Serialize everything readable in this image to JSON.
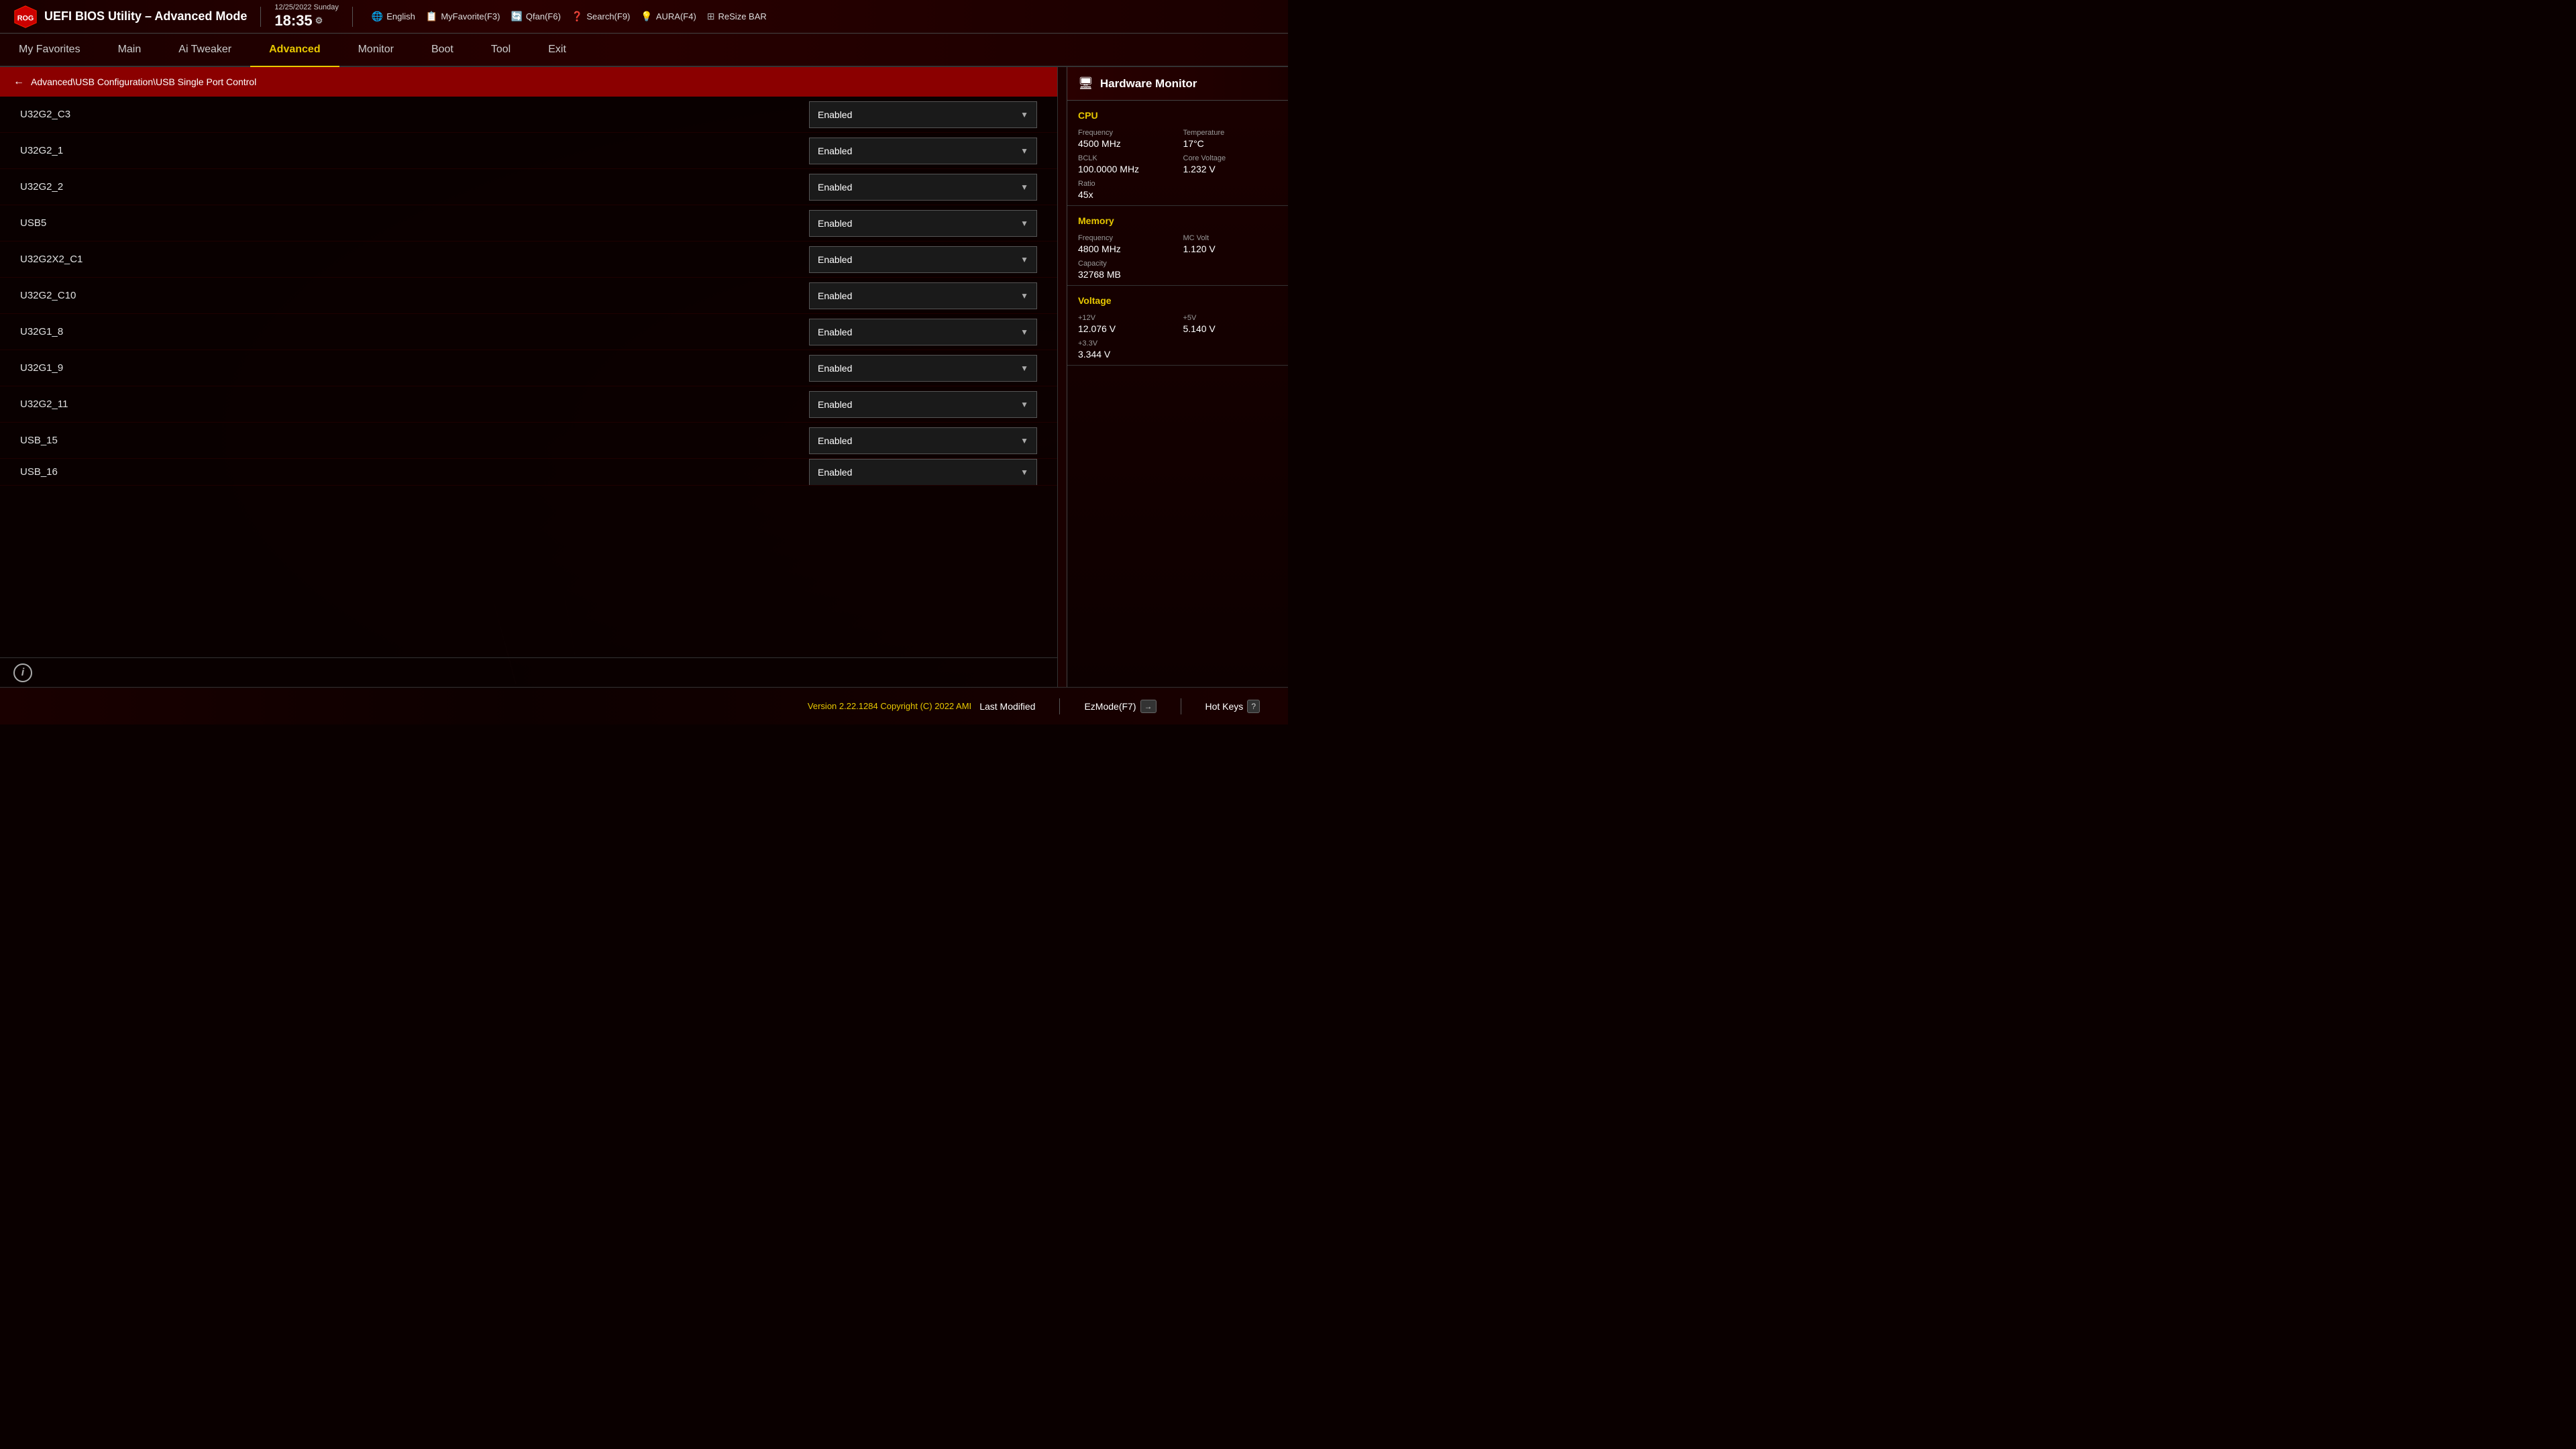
{
  "header": {
    "title": "UEFI BIOS Utility – Advanced Mode",
    "date": "12/25/2022",
    "day": "Sunday",
    "time": "18:35",
    "tools": [
      {
        "id": "english",
        "icon": "🌐",
        "label": "English"
      },
      {
        "id": "myfavorite",
        "icon": "📋",
        "label": "MyFavorite(F3)"
      },
      {
        "id": "qfan",
        "icon": "🔄",
        "label": "Qfan(F6)"
      },
      {
        "id": "search",
        "icon": "❓",
        "label": "Search(F9)"
      },
      {
        "id": "aura",
        "icon": "💡",
        "label": "AURA(F4)"
      },
      {
        "id": "resizebar",
        "icon": "⊞",
        "label": "ReSize BAR"
      }
    ]
  },
  "nav": {
    "items": [
      {
        "id": "my-favorites",
        "label": "My Favorites",
        "active": false
      },
      {
        "id": "main",
        "label": "Main",
        "active": false
      },
      {
        "id": "ai-tweaker",
        "label": "Ai Tweaker",
        "active": false
      },
      {
        "id": "advanced",
        "label": "Advanced",
        "active": true
      },
      {
        "id": "monitor",
        "label": "Monitor",
        "active": false
      },
      {
        "id": "boot",
        "label": "Boot",
        "active": false
      },
      {
        "id": "tool",
        "label": "Tool",
        "active": false
      },
      {
        "id": "exit",
        "label": "Exit",
        "active": false
      }
    ]
  },
  "breadcrumb": {
    "path": "Advanced\\USB Configuration\\USB Single Port Control"
  },
  "settings": [
    {
      "label": "U32G2_C3",
      "value": "Enabled"
    },
    {
      "label": "U32G2_1",
      "value": "Enabled"
    },
    {
      "label": "U32G2_2",
      "value": "Enabled"
    },
    {
      "label": "USB5",
      "value": "Enabled"
    },
    {
      "label": "U32G2X2_C1",
      "value": "Enabled"
    },
    {
      "label": "U32G2_C10",
      "value": "Enabled"
    },
    {
      "label": "U32G1_8",
      "value": "Enabled"
    },
    {
      "label": "U32G1_9",
      "value": "Enabled"
    },
    {
      "label": "U32G2_11",
      "value": "Enabled"
    },
    {
      "label": "USB_15",
      "value": "Enabled"
    },
    {
      "label": "USB_16",
      "value": "Enabled"
    }
  ],
  "hardware_monitor": {
    "title": "Hardware Monitor",
    "cpu": {
      "section_title": "CPU",
      "stats": [
        {
          "label": "Frequency",
          "value": "4500 MHz"
        },
        {
          "label": "Temperature",
          "value": "17°C"
        },
        {
          "label": "BCLK",
          "value": "100.0000 MHz"
        },
        {
          "label": "Core Voltage",
          "value": "1.232 V"
        },
        {
          "label": "Ratio",
          "value": "45x"
        }
      ]
    },
    "memory": {
      "section_title": "Memory",
      "stats": [
        {
          "label": "Frequency",
          "value": "4800 MHz"
        },
        {
          "label": "MC Volt",
          "value": "1.120 V"
        },
        {
          "label": "Capacity",
          "value": "32768 MB"
        }
      ]
    },
    "voltage": {
      "section_title": "Voltage",
      "stats": [
        {
          "label": "+12V",
          "value": "12.076 V"
        },
        {
          "label": "+5V",
          "value": "5.140 V"
        },
        {
          "label": "+3.3V",
          "value": "3.344 V"
        }
      ]
    }
  },
  "footer": {
    "version": "Version 2.22.1284 Copyright (C) 2022 AMI",
    "buttons": [
      {
        "id": "last-modified",
        "label": "Last Modified"
      },
      {
        "id": "ezmode",
        "label": "EzMode(F7)"
      },
      {
        "id": "hot-keys",
        "label": "Hot Keys"
      }
    ]
  }
}
